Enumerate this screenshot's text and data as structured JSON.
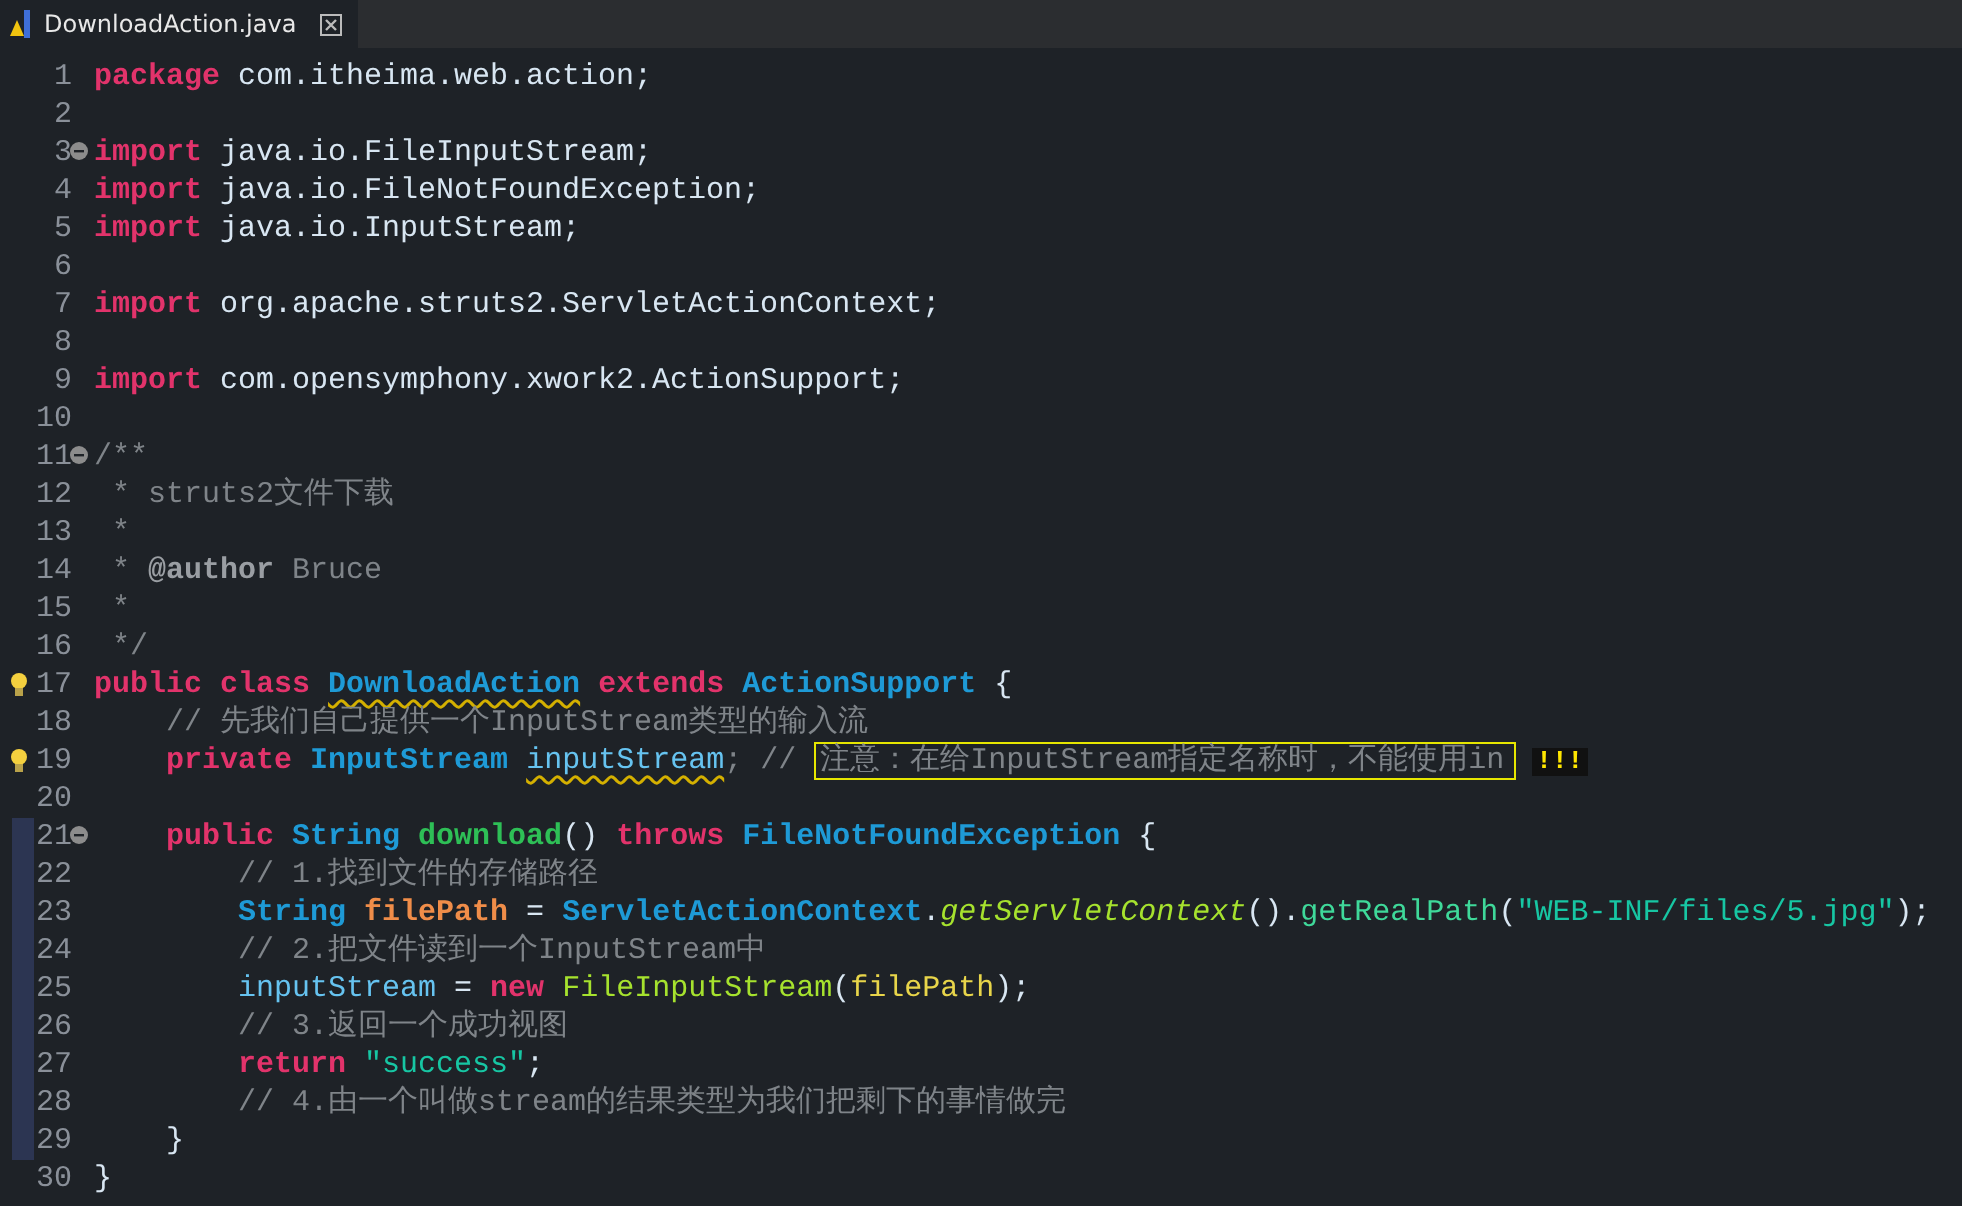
{
  "tab": {
    "title": "DownloadAction.java",
    "selected": true
  },
  "lines": [
    {
      "number": "1",
      "range": false,
      "tokens": [
        {
          "text": "package",
          "kind": "keyword"
        },
        {
          "text": " com.itheima.web.action;",
          "kind": "plain"
        }
      ]
    },
    {
      "number": "2",
      "range": false
    },
    {
      "number": "3",
      "marker": {
        "kind": "fold"
      },
      "range": false,
      "tokens": [
        {
          "text": "import",
          "kind": "keyword"
        },
        {
          "text": " java.io.FileInputStream;",
          "kind": "plain"
        }
      ]
    },
    {
      "number": "4",
      "range": false,
      "tokens": [
        {
          "text": "import",
          "kind": "keyword"
        },
        {
          "text": " java.io.FileNotFoundException;",
          "kind": "plain"
        }
      ]
    },
    {
      "number": "5",
      "range": false,
      "tokens": [
        {
          "text": "import",
          "kind": "keyword"
        },
        {
          "text": " java.io.InputStream;",
          "kind": "plain"
        }
      ]
    },
    {
      "number": "6",
      "range": false
    },
    {
      "number": "7",
      "range": false,
      "tokens": [
        {
          "text": "import",
          "kind": "keyword"
        },
        {
          "text": " org.apache.struts2.ServletActionContext;",
          "kind": "plain"
        }
      ]
    },
    {
      "number": "8",
      "range": false
    },
    {
      "number": "9",
      "range": false,
      "tokens": [
        {
          "text": "import",
          "kind": "keyword"
        },
        {
          "text": " com.opensymphony.xwork2.ActionSupport;",
          "kind": "plain"
        }
      ]
    },
    {
      "number": "10",
      "range": false
    },
    {
      "number": "11",
      "marker": {
        "kind": "fold"
      },
      "range": false,
      "tokens": [
        {
          "text": "/**",
          "kind": "doc"
        }
      ]
    },
    {
      "number": "12",
      "range": false,
      "tokens": [
        {
          "text": " * struts2文件下载",
          "kind": "doc"
        }
      ]
    },
    {
      "number": "13",
      "range": false,
      "tokens": [
        {
          "text": " *",
          "kind": "doc"
        }
      ]
    },
    {
      "number": "14",
      "range": false,
      "tokens": [
        {
          "text": " * ",
          "kind": "doc"
        },
        {
          "text": "@author",
          "kind": "doctag"
        },
        {
          "text": " Bruce",
          "kind": "doc"
        }
      ]
    },
    {
      "number": "15",
      "range": false,
      "tokens": [
        {
          "text": " *",
          "kind": "doc"
        }
      ]
    },
    {
      "number": "16",
      "range": false,
      "tokens": [
        {
          "text": " */",
          "kind": "doc"
        }
      ]
    },
    {
      "number": "17",
      "marker": {
        "kind": "bulb"
      },
      "range": false,
      "tokens": [
        {
          "text": "public class ",
          "kind": "keyword"
        },
        {
          "text": "DownloadAction",
          "kind": "warnedclass"
        },
        {
          "text": " extends ",
          "kind": "keyword"
        },
        {
          "text": "ActionSupport",
          "kind": "type"
        },
        {
          "text": " {",
          "kind": "plain"
        }
      ]
    },
    {
      "number": "18",
      "range": false,
      "tokens": [
        {
          "text": "    // 先我们自己提供一个InputStream类型的输入流",
          "kind": "comment"
        }
      ]
    },
    {
      "number": "19",
      "marker": {
        "kind": "bulb"
      },
      "range": false,
      "tokens": [
        {
          "text": "    private ",
          "kind": "keyword"
        },
        {
          "text": "InputStream ",
          "kind": "type"
        },
        {
          "text": "inputStream",
          "kind": "warnedfield"
        },
        {
          "text": "; // ",
          "kind": "comment"
        },
        {
          "text": "注意：在给InputStream指定名称时，不能使用in",
          "kind": "boxed"
        },
        {
          "text": "!!!",
          "kind": "alert"
        }
      ]
    },
    {
      "number": "20",
      "range": false
    },
    {
      "number": "21",
      "marker": {
        "kind": "fold"
      },
      "range": true,
      "tokens": [
        {
          "text": "    public ",
          "kind": "keyword"
        },
        {
          "text": "String ",
          "kind": "type"
        },
        {
          "text": "download",
          "kind": "methoddecl"
        },
        {
          "text": "() ",
          "kind": "plain"
        },
        {
          "text": "throws ",
          "kind": "keyword"
        },
        {
          "text": "FileNotFoundException",
          "kind": "type"
        },
        {
          "text": " {",
          "kind": "plain"
        }
      ]
    },
    {
      "number": "22",
      "range": true,
      "tokens": [
        {
          "text": "        // 1.找到文件的存储路径",
          "kind": "comment"
        }
      ]
    },
    {
      "number": "23",
      "range": true,
      "tokens": [
        {
          "text": "        String ",
          "kind": "type"
        },
        {
          "text": "filePath",
          "kind": "localdecl"
        },
        {
          "text": " = ",
          "kind": "plain"
        },
        {
          "text": "ServletActionContext",
          "kind": "type"
        },
        {
          "text": ".",
          "kind": "plain"
        },
        {
          "text": "getServletContext",
          "kind": "staticcall"
        },
        {
          "text": "().",
          "kind": "plain"
        },
        {
          "text": "getRealPath",
          "kind": "call"
        },
        {
          "text": "(",
          "kind": "plain"
        },
        {
          "text": "\"WEB-INF/files/5.jpg\"",
          "kind": "string"
        },
        {
          "text": ");",
          "kind": "plain"
        }
      ]
    },
    {
      "number": "24",
      "range": true,
      "tokens": [
        {
          "text": "        // 2.把文件读到一个InputStream中",
          "kind": "comment"
        }
      ]
    },
    {
      "number": "25",
      "range": true,
      "tokens": [
        {
          "text": "        inputStream",
          "kind": "field"
        },
        {
          "text": " = ",
          "kind": "plain"
        },
        {
          "text": "new ",
          "kind": "keyword"
        },
        {
          "text": "FileInputStream",
          "kind": "staticplain"
        },
        {
          "text": "(",
          "kind": "plain"
        },
        {
          "text": "filePath",
          "kind": "local"
        },
        {
          "text": ");",
          "kind": "plain"
        }
      ]
    },
    {
      "number": "26",
      "range": true,
      "tokens": [
        {
          "text": "        // 3.返回一个成功视图",
          "kind": "comment"
        }
      ]
    },
    {
      "number": "27",
      "range": true,
      "tokens": [
        {
          "text": "        return ",
          "kind": "keyword"
        },
        {
          "text": "\"success\"",
          "kind": "string"
        },
        {
          "text": ";",
          "kind": "plain"
        }
      ]
    },
    {
      "number": "28",
      "range": true,
      "tokens": [
        {
          "text": "        // 4.由一个叫做stream的结果类型为我们把剩下的事情做完",
          "kind": "comment"
        }
      ]
    },
    {
      "number": "29",
      "range": true,
      "tokens": [
        {
          "text": "    }",
          "kind": "plain"
        }
      ]
    },
    {
      "number": "30",
      "range": false,
      "tokens": [
        {
          "text": "}",
          "kind": "plain"
        }
      ]
    }
  ]
}
